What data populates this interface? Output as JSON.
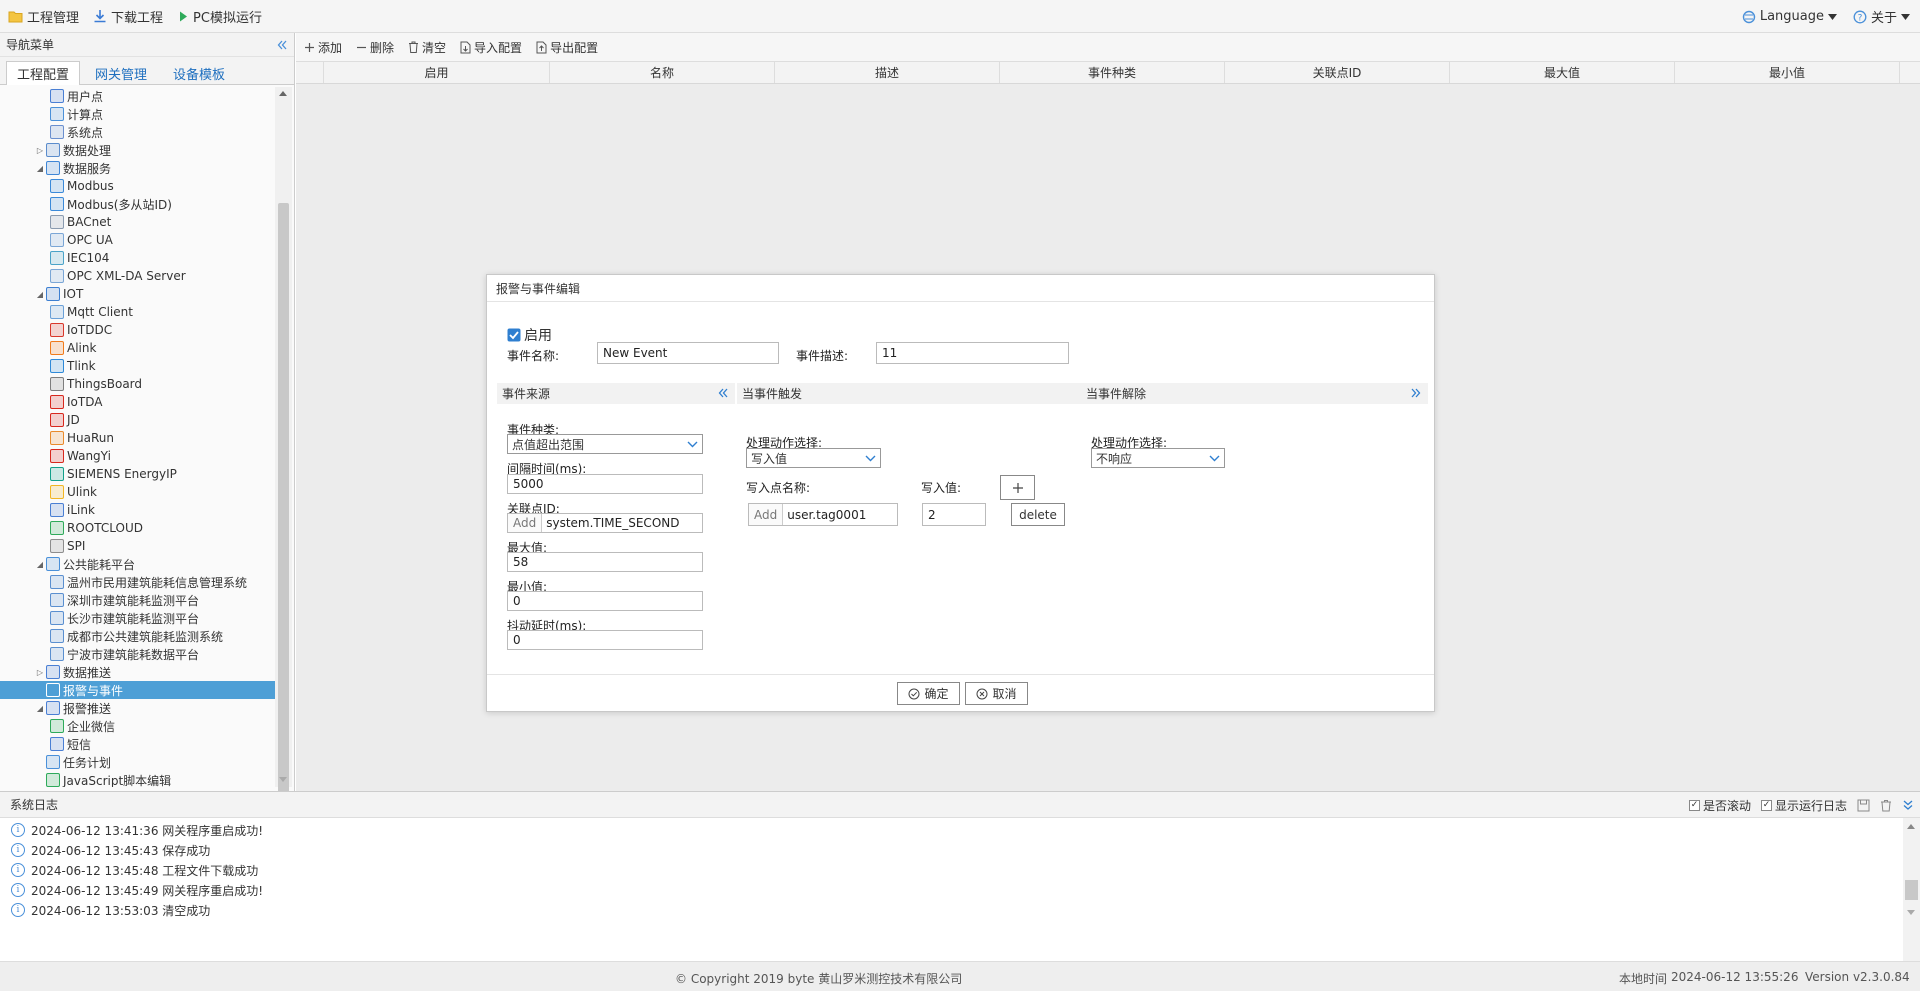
{
  "topbar": {
    "project_mgmt": "工程管理",
    "download": "下载工程",
    "simulate": "PC模拟运行",
    "language": "Language",
    "about": "关于"
  },
  "nav": {
    "title": "导航菜单",
    "tabs": [
      "工程配置",
      "网关管理",
      "设备模板"
    ],
    "tree": [
      {
        "label": "用户点",
        "level": 2,
        "icon": "user-point-icon",
        "color": "#4a7fd4"
      },
      {
        "label": "计算点",
        "level": 2,
        "icon": "calc-point-icon",
        "color": "#4a90d9"
      },
      {
        "label": "系统点",
        "level": 2,
        "icon": "system-point-icon",
        "color": "#6a8fcf"
      },
      {
        "label": "数据处理",
        "level": 1,
        "expander": "right",
        "icon": "data-process-icon",
        "color": "#5b8ccc"
      },
      {
        "label": "数据服务",
        "level": 1,
        "expander": "down",
        "icon": "data-service-icon",
        "color": "#3f86d6"
      },
      {
        "label": "Modbus",
        "level": 2,
        "icon": "modbus-icon",
        "color": "#3b8ad9"
      },
      {
        "label": "Modbus(多从站ID)",
        "level": 2,
        "icon": "modbus-multi-icon",
        "color": "#3b8ad9"
      },
      {
        "label": "BACnet",
        "level": 2,
        "icon": "bacnet-icon",
        "color": "#8a9bb0"
      },
      {
        "label": "OPC UA",
        "level": 2,
        "icon": "opc-ua-icon",
        "color": "#7aa6d6"
      },
      {
        "label": "IEC104",
        "level": 2,
        "icon": "iec104-icon",
        "color": "#4aa3c8"
      },
      {
        "label": "OPC XML-DA Server",
        "level": 2,
        "icon": "opc-xml-icon",
        "color": "#7aa6d6"
      },
      {
        "label": "IOT",
        "level": 1,
        "expander": "down",
        "icon": "iot-icon",
        "color": "#3d7fd1"
      },
      {
        "label": "Mqtt Client",
        "level": 2,
        "icon": "mqtt-icon",
        "color": "#6aa0d8"
      },
      {
        "label": "IoTDDC",
        "level": 2,
        "icon": "iotddc-icon",
        "color": "#d9372c"
      },
      {
        "label": "Alink",
        "level": 2,
        "icon": "alink-icon",
        "color": "#f07a1a"
      },
      {
        "label": "Tlink",
        "level": 2,
        "icon": "tlink-icon",
        "color": "#2f8ad8"
      },
      {
        "label": "ThingsBoard",
        "level": 2,
        "icon": "thingsboard-icon",
        "color": "#7d7d7d"
      },
      {
        "label": "IoTDA",
        "level": 2,
        "icon": "iotda-icon",
        "color": "#d8281e"
      },
      {
        "label": "JD",
        "level": 2,
        "icon": "jd-icon",
        "color": "#d8281e"
      },
      {
        "label": "HuaRun",
        "level": 2,
        "icon": "huarun-icon",
        "color": "#e98a2b"
      },
      {
        "label": "WangYi",
        "level": 2,
        "icon": "wangyi-icon",
        "color": "#d8281e"
      },
      {
        "label": "SIEMENS EnergyIP",
        "level": 2,
        "icon": "siemens-icon",
        "color": "#12a08a"
      },
      {
        "label": "Ulink",
        "level": 2,
        "icon": "ulink-icon",
        "color": "#f2b623"
      },
      {
        "label": "iLink",
        "level": 2,
        "icon": "ilink-icon",
        "color": "#4a7fd4"
      },
      {
        "label": "ROOTCLOUD",
        "level": 2,
        "icon": "rootcloud-icon",
        "color": "#2eaa5a"
      },
      {
        "label": "SPI",
        "level": 2,
        "icon": "spi-icon",
        "color": "#8d8d8d"
      },
      {
        "label": "公共能耗平台",
        "level": 1,
        "expander": "down",
        "icon": "energy-platform-icon",
        "color": "#4a90d9"
      },
      {
        "label": "温州市民用建筑能耗信息管理系统",
        "level": 2,
        "icon": "doc-icon",
        "color": "#5a8fd0"
      },
      {
        "label": "深圳市建筑能耗监测平台",
        "level": 2,
        "icon": "doc-icon",
        "color": "#5a8fd0"
      },
      {
        "label": "长沙市建筑能耗监测平台",
        "level": 2,
        "icon": "doc-icon",
        "color": "#5a8fd0"
      },
      {
        "label": "成都市公共建筑能耗监测系统",
        "level": 2,
        "icon": "doc-icon",
        "color": "#5a8fd0"
      },
      {
        "label": "宁波市建筑能耗数据平台",
        "level": 2,
        "icon": "doc-icon",
        "color": "#5a8fd0"
      },
      {
        "label": "数据推送",
        "level": 1,
        "expander": "right",
        "icon": "data-push-icon",
        "color": "#4a7fd4"
      },
      {
        "label": "报警与事件",
        "level": 1,
        "icon": "alarm-event-icon",
        "color": "#ffffff",
        "selected": true
      },
      {
        "label": "报警推送",
        "level": 1,
        "expander": "down",
        "icon": "alarm-push-icon",
        "color": "#4a7fd4"
      },
      {
        "label": "企业微信",
        "level": 2,
        "icon": "wechat-work-icon",
        "color": "#2eaa5a"
      },
      {
        "label": "短信",
        "level": 2,
        "icon": "sms-icon",
        "color": "#4a7fd4"
      },
      {
        "label": "任务计划",
        "level": 1,
        "icon": "task-plan-icon",
        "color": "#4a90d9"
      },
      {
        "label": "JavaScript脚本编辑",
        "level": 1,
        "icon": "js-editor-icon",
        "color": "#2eaa5a"
      }
    ]
  },
  "toolbar": {
    "add": "添加",
    "delete": "删除",
    "clear": "清空",
    "import": "导入配置",
    "export": "导出配置"
  },
  "grid": {
    "columns": [
      "启用",
      "名称",
      "描述",
      "事件种类",
      "关联点ID",
      "最大值",
      "最小值"
    ]
  },
  "dialog": {
    "title": "报警与事件编辑",
    "enable_label": "启用",
    "enabled": true,
    "event_name_label": "事件名称:",
    "event_name_value": "New Event",
    "event_desc_label": "事件描述:",
    "event_desc_value": "11",
    "source_title": "事件来源",
    "trigger_title": "当事件触发",
    "release_title": "当事件解除",
    "event_type_label": "事件种类:",
    "event_type_value": "点值超出范围",
    "interval_label": "间隔时间(ms):",
    "interval_value": "5000",
    "point_id_label": "关联点ID:",
    "point_id_add": "Add",
    "point_id_value": "system.TIME_SECOND",
    "max_label": "最大值:",
    "max_value": "58",
    "min_label": "最小值:",
    "min_value": "0",
    "debounce_label": "抖动延时(ms):",
    "debounce_value": "0",
    "trigger_action_label": "处理动作选择:",
    "trigger_action_value": "写入值",
    "write_point_label": "写入点名称:",
    "write_value_label": "写入值:",
    "write_point_add": "Add",
    "write_point_value": "user.tag0001",
    "write_value": "2",
    "delete_btn": "delete",
    "release_action_label": "处理动作选择:",
    "release_action_value": "不响应",
    "ok": "确定",
    "cancel": "取消"
  },
  "log": {
    "title": "系统日志",
    "scroll_label": "是否滚动",
    "show_run_label": "显示运行日志",
    "entries": [
      "2024-06-12 13:41:36 网关程序重启成功!",
      "2024-06-12 13:45:43 保存成功",
      "2024-06-12 13:45:48 工程文件下载成功",
      "2024-06-12 13:45:49 网关程序重启成功!",
      "2024-06-12 13:53:03 清空成功"
    ]
  },
  "footer": {
    "copyright": "© Copyright 2019 byte 黄山罗米测控技术有限公司",
    "local_time_label": "本地时间",
    "local_time": "2024-06-12 13:55:26",
    "version": "Version v2.3.0.84"
  }
}
